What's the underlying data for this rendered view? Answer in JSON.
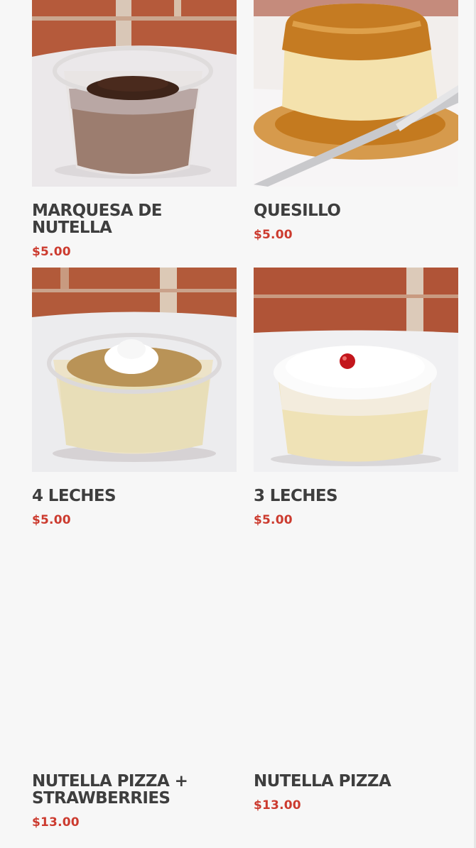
{
  "products": [
    {
      "name": "MARQUESA DE NUTELLA",
      "price": "$5.00",
      "image": "chocolate-dessert-cup"
    },
    {
      "name": "QUESILLO",
      "price": "$5.00",
      "image": "flan-with-caramel"
    },
    {
      "name": "4 LECHES",
      "price": "$5.00",
      "image": "four-leches-cup"
    },
    {
      "name": "3 LECHES",
      "price": "$5.00",
      "image": "three-leches-cup"
    },
    {
      "name": "NUTELLA PIZZA + STRAWBERRIES",
      "price": "$13.00",
      "image": ""
    },
    {
      "name": "NUTELLA PIZZA",
      "price": "$13.00",
      "image": ""
    }
  ],
  "colors": {
    "price": "#cc3b2f",
    "title": "#3e3e3e",
    "background": "#f7f7f7"
  }
}
